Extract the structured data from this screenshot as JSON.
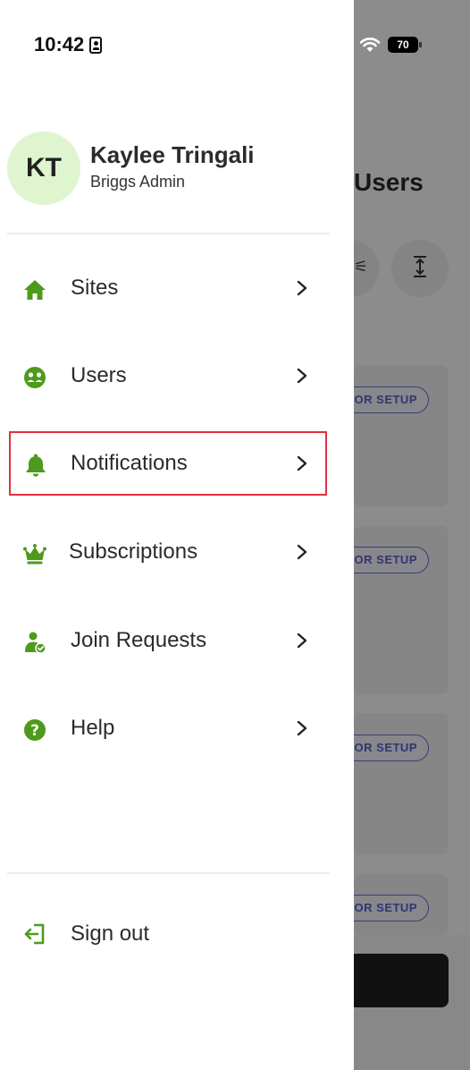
{
  "status_bar": {
    "time": "10:42",
    "battery": "70"
  },
  "background": {
    "title": "Users",
    "status_chip": "OR SETUP"
  },
  "user": {
    "initials": "KT",
    "name": "Kaylee Tringali",
    "role": "Briggs Admin"
  },
  "menu": {
    "items": [
      {
        "label": "Sites",
        "icon": "home-icon"
      },
      {
        "label": "Users",
        "icon": "users-icon"
      },
      {
        "label": "Notifications",
        "icon": "bell-icon"
      },
      {
        "label": "Subscriptions",
        "icon": "crown-icon"
      },
      {
        "label": "Join Requests",
        "icon": "user-check-icon"
      },
      {
        "label": "Help",
        "icon": "help-icon"
      }
    ],
    "signout_label": "Sign out"
  },
  "colors": {
    "accent_green": "#4f9a1c",
    "highlight_red": "#e0313f",
    "avatar_bg": "#dff5cf",
    "chip_purple": "#5b5fd0"
  }
}
